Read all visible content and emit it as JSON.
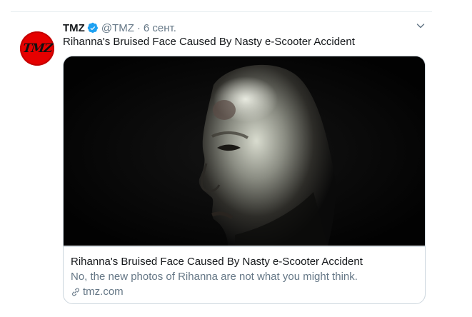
{
  "tweet": {
    "author_name": "TMZ",
    "handle": "@TMZ",
    "separator": "·",
    "time": "6 сент.",
    "avatar_logo": "TMZ",
    "text": "Rihanna's Bruised Face Caused By Nasty e-Scooter Accident",
    "icons": {
      "verified": "verified-badge-icon",
      "caret": "chevron-down-icon",
      "link": "link-icon"
    }
  },
  "card": {
    "title": "Rihanna's Bruised Face Caused By Nasty e-Scooter Accident",
    "description": "No, the new photos of Rihanna are not what you might think.",
    "domain": "tmz.com"
  },
  "colors": {
    "verified": "#1da1f2",
    "avatar_bg": "#e60000",
    "secondary_text": "#657786",
    "border": "#ccd6dd"
  }
}
